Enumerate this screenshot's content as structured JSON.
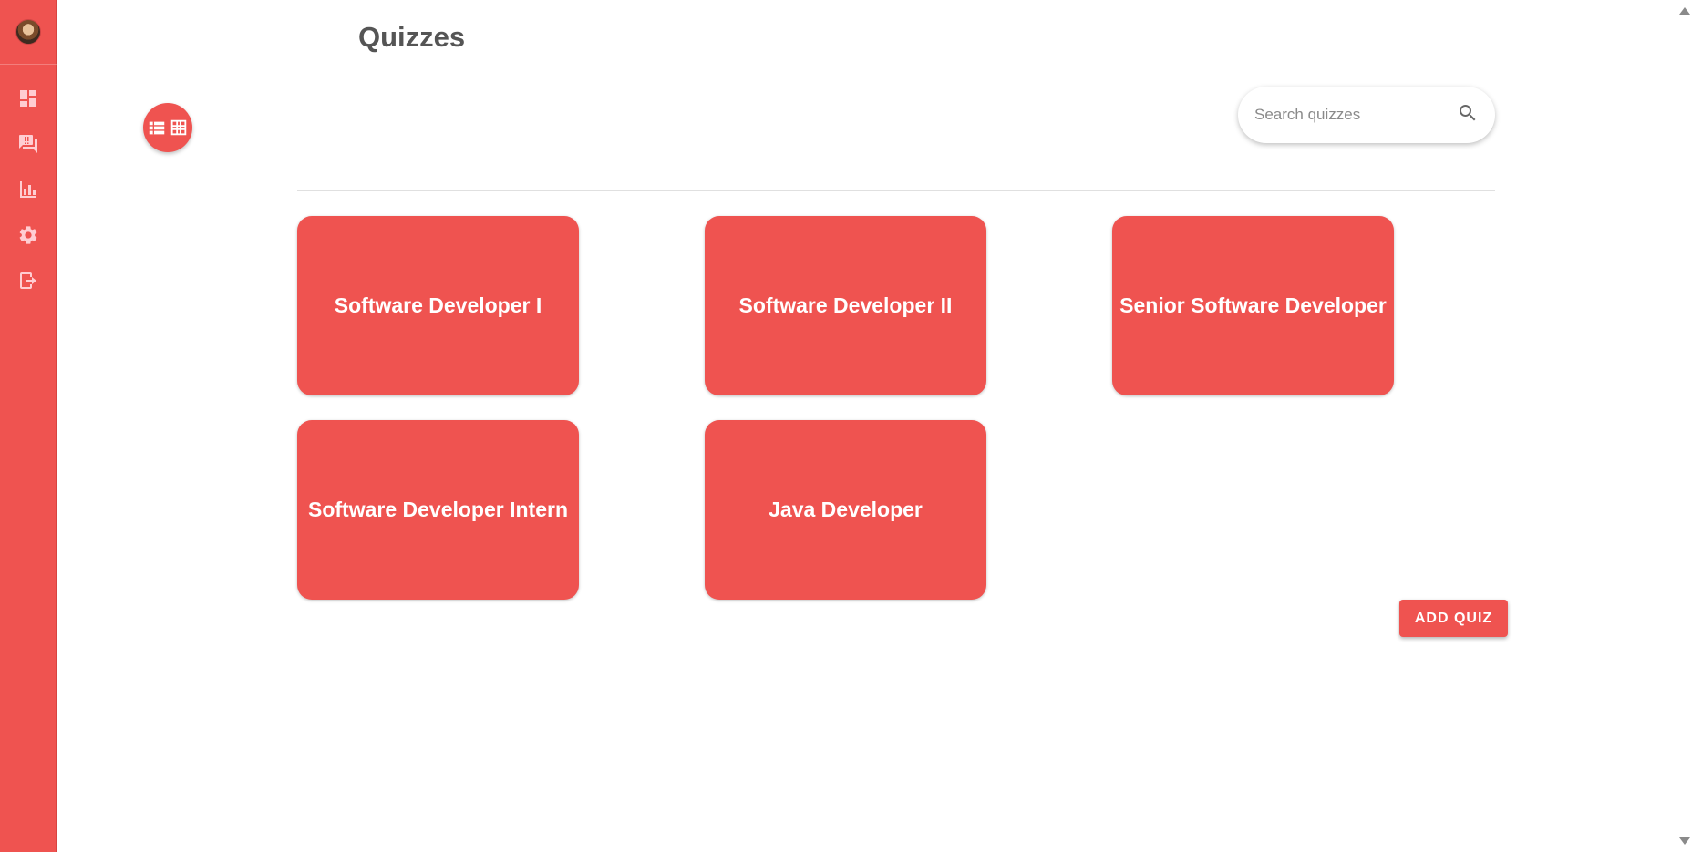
{
  "page": {
    "title": "Quizzes"
  },
  "sidebar": {
    "items": [
      {
        "icon": "dashboard-icon"
      },
      {
        "icon": "quiz-forum-icon"
      },
      {
        "icon": "bar-chart-icon"
      },
      {
        "icon": "gear-icon"
      },
      {
        "icon": "logout-icon"
      }
    ]
  },
  "search": {
    "placeholder": "Search quizzes",
    "value": ""
  },
  "quizzes": [
    {
      "label": "Software Developer I"
    },
    {
      "label": "Software Developer II"
    },
    {
      "label": "Senior Software Developer"
    },
    {
      "label": "Software Developer Intern"
    },
    {
      "label": "Java Developer"
    }
  ],
  "actions": {
    "add_quiz_label": "ADD QUIZ"
  },
  "colors": {
    "accent": "#ef5350",
    "title_text": "#555555",
    "card_text": "#ffffff"
  }
}
